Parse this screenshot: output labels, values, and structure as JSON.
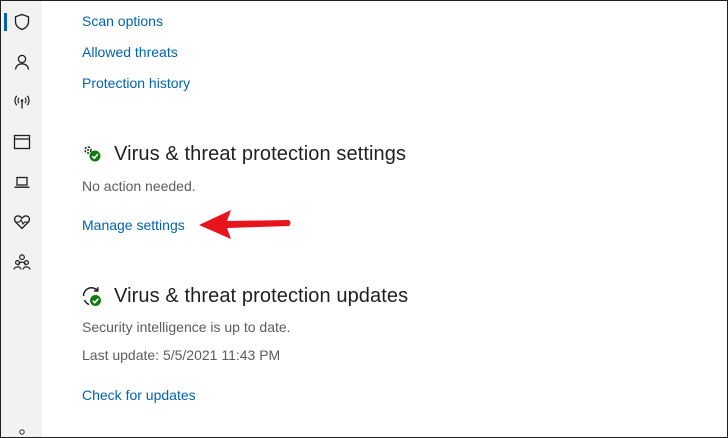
{
  "sidebar": {
    "items": [
      {
        "icon": "shield-icon",
        "active": true
      },
      {
        "icon": "person-icon",
        "active": false
      },
      {
        "icon": "wireless-icon",
        "active": false
      },
      {
        "icon": "browser-window-icon",
        "active": false
      },
      {
        "icon": "laptop-icon",
        "active": false
      },
      {
        "icon": "heart-pulse-icon",
        "active": false
      },
      {
        "icon": "family-icon",
        "active": false
      }
    ]
  },
  "links_top": {
    "scan_options": "Scan options",
    "allowed_threats": "Allowed threats",
    "protection_history": "Protection history"
  },
  "settings_section": {
    "icon": "settings-gear-check-icon",
    "title": "Virus & threat protection settings",
    "status": "No action needed.",
    "link": "Manage settings"
  },
  "updates_section": {
    "icon": "refresh-check-icon",
    "title": "Virus & threat protection updates",
    "status": "Security intelligence is up to date.",
    "last_update": "Last update: 5/5/2021 11:43 PM",
    "link": "Check for updates"
  },
  "annotation": {
    "icon": "red-arrow-icon",
    "color": "#e8141c"
  },
  "colors": {
    "link": "#0063b1",
    "sidebar_bg": "#f2f2f2",
    "ok_green": "#107c10"
  }
}
